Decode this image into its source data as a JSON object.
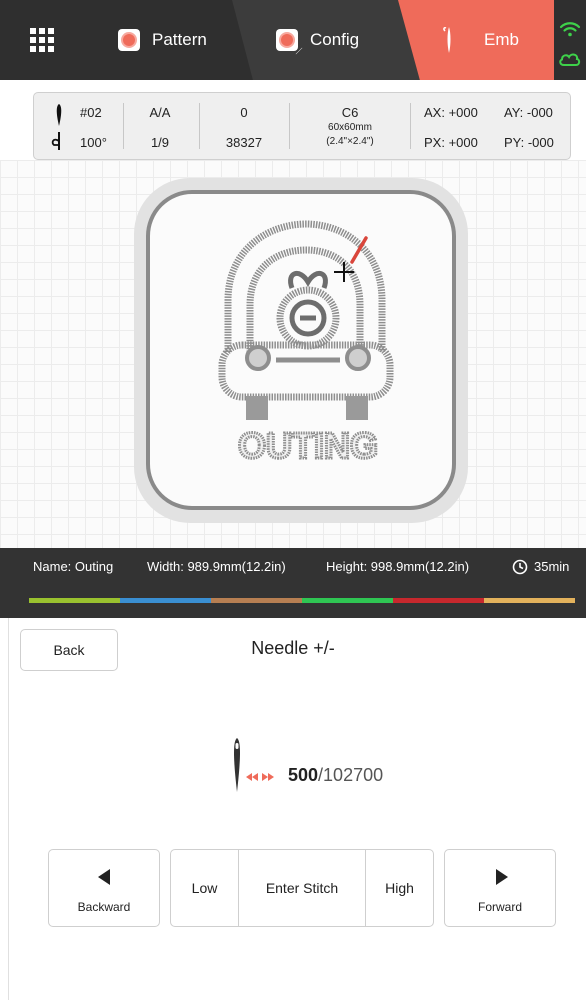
{
  "tabs": {
    "pattern": "Pattern",
    "config": "Config",
    "emb": "Emb"
  },
  "info": {
    "needle_number": "#02",
    "angle": "100°",
    "aa": "A/A",
    "fraction": "1/9",
    "zero": "0",
    "stitches": "38327",
    "hoop_code": "C6",
    "hoop_mm": "60x60mm",
    "hoop_in": "(2.4\"×2.4\")",
    "ax": "AX: +000",
    "ay": "AY: -000",
    "px": "PX: +000",
    "py": "PY: -000"
  },
  "design": {
    "word": "OUTING"
  },
  "strip": {
    "name": "Name: Outing",
    "width": "Width: 989.9mm(12.2in)",
    "height": "Height: 998.9mm(12.2in)",
    "time": "35min",
    "colors": [
      "#9ac22f",
      "#3a8fd2",
      "#b77f52",
      "#2fc653",
      "#c7282d",
      "#e3b25c"
    ]
  },
  "panel": {
    "back": "Back",
    "title": "Needle +/-",
    "current": "500",
    "total": "/102700",
    "backward": "Backward",
    "low": "Low",
    "enter": "Enter Stitch",
    "high": "High",
    "forward": "Forward"
  },
  "colors": {
    "accent": "#ef6b5a",
    "dark": "#2f2f2f",
    "wifi": "#3ed14a"
  }
}
